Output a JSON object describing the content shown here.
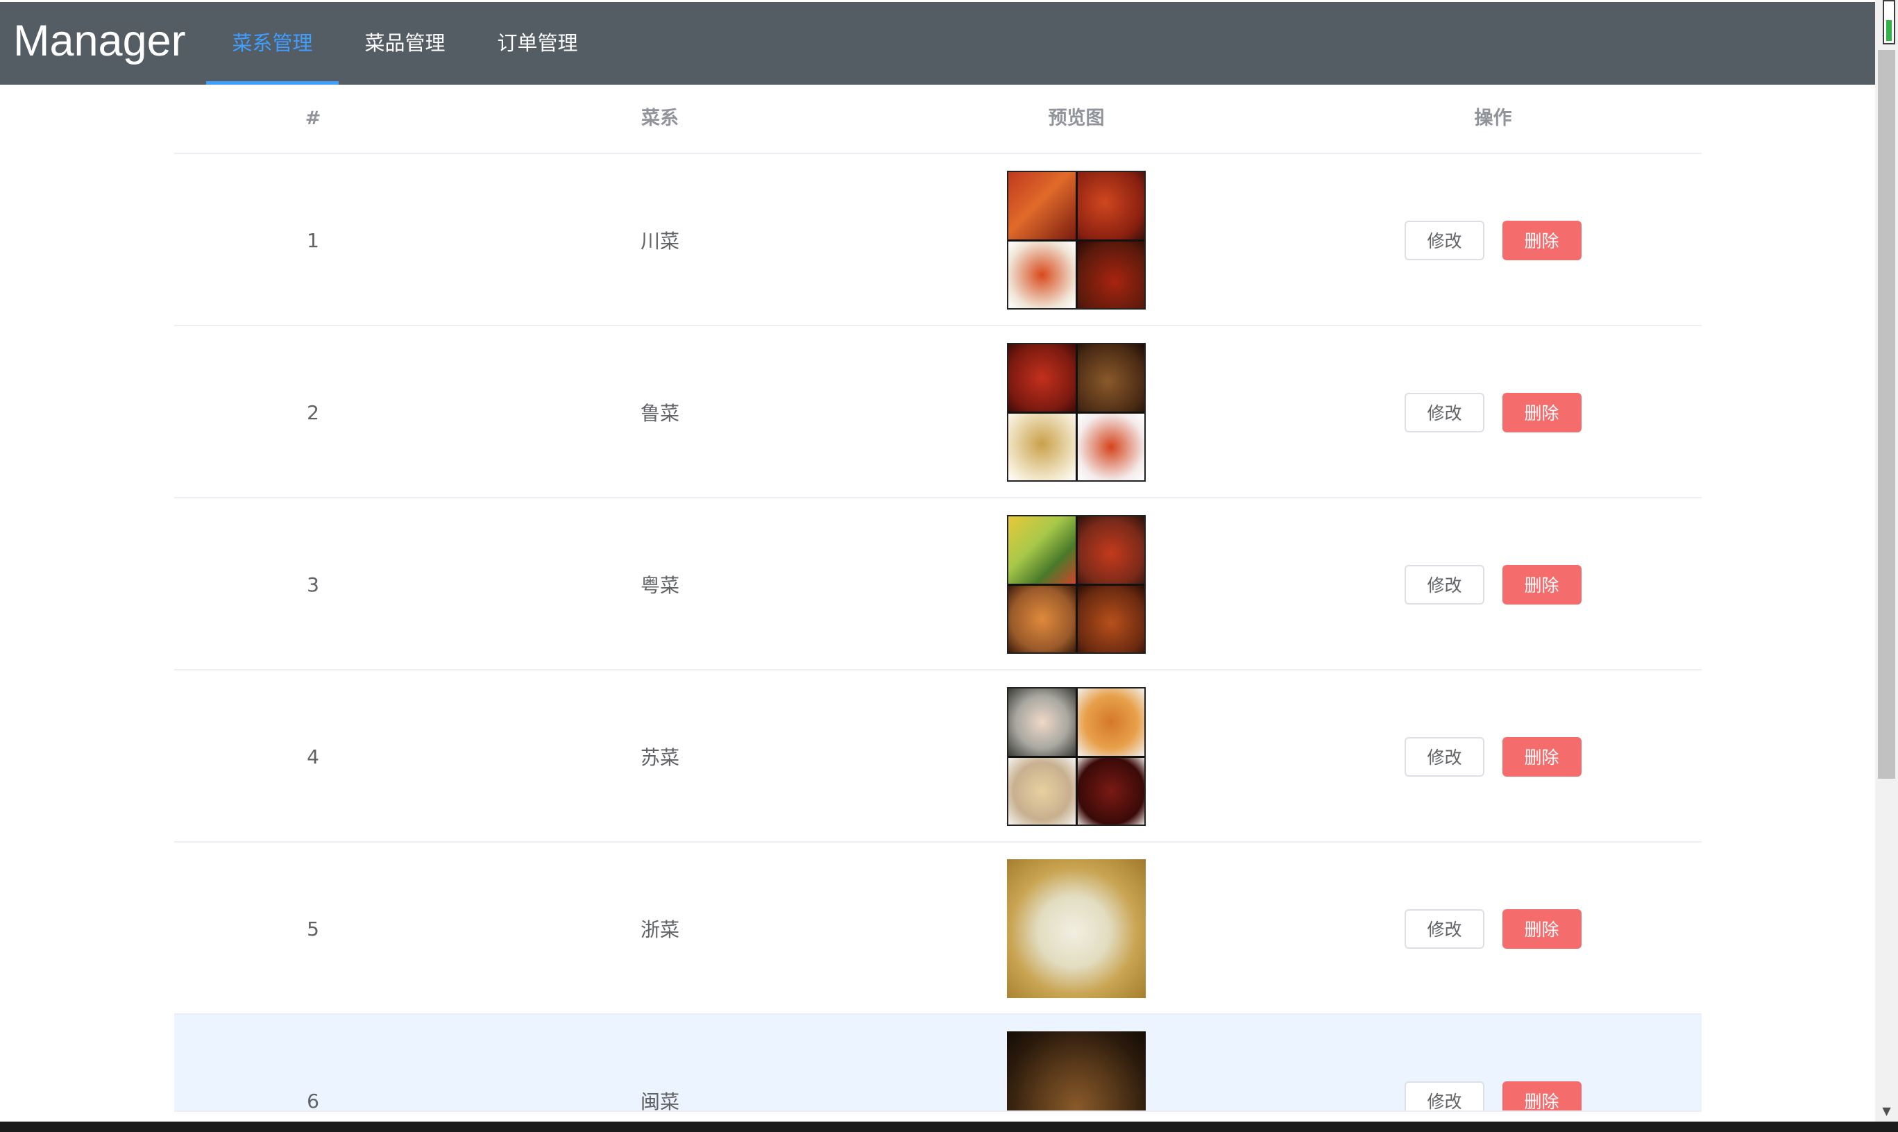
{
  "header": {
    "brand": "Manager",
    "nav": [
      {
        "label": "菜系管理",
        "active": true
      },
      {
        "label": "菜品管理",
        "active": false
      },
      {
        "label": "订单管理",
        "active": false
      }
    ],
    "active_color": "#409eff",
    "background": "#545c64"
  },
  "table": {
    "columns": [
      "#",
      "菜系",
      "预览图",
      "操作"
    ],
    "rows": [
      {
        "index": "1",
        "name": "川菜",
        "preview": "sichuan-dishes-collage"
      },
      {
        "index": "2",
        "name": "鲁菜",
        "preview": "shandong-dishes-collage"
      },
      {
        "index": "3",
        "name": "粤菜",
        "preview": "cantonese-dishes-collage"
      },
      {
        "index": "4",
        "name": "苏菜",
        "preview": "jiangsu-dishes-collage"
      },
      {
        "index": "5",
        "name": "浙菜",
        "preview": "zhejiang-soup-photo"
      },
      {
        "index": "6",
        "name": "闽菜",
        "preview": "fujian-pot-photo"
      }
    ],
    "edit_label": "修改",
    "delete_label": "删除",
    "delete_color": "#f56c6c"
  }
}
